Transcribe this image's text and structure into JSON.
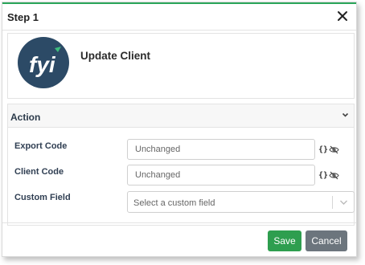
{
  "dialog": {
    "title": "Step 1",
    "accent_color": "#2aa65a",
    "close_icon": "close-icon"
  },
  "step": {
    "logo_text": "fyi",
    "logo_bg": "#2c4a66",
    "name": "Update Client"
  },
  "action": {
    "title": "Action",
    "fields": [
      {
        "label": "Export Code",
        "placeholder": "Unchanged",
        "value": ""
      },
      {
        "label": "Client Code",
        "placeholder": "Unchanged",
        "value": ""
      }
    ],
    "custom_field": {
      "label": "Custom Field",
      "placeholder": "Select a custom field"
    },
    "field_icons": [
      "braces-icon",
      "eye-slash-icon"
    ]
  },
  "footer": {
    "save_label": "Save",
    "cancel_label": "Cancel",
    "save_color": "#2e9e4f",
    "cancel_color": "#6c757d"
  }
}
